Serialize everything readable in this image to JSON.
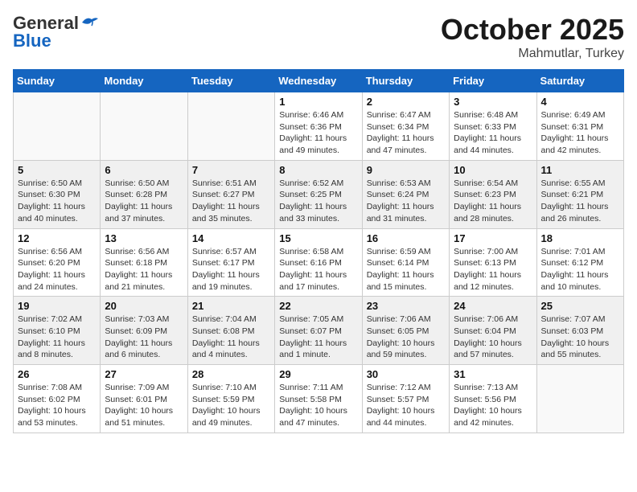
{
  "header": {
    "logo_general": "General",
    "logo_blue": "Blue",
    "month": "October 2025",
    "location": "Mahmutlar, Turkey"
  },
  "days_of_week": [
    "Sunday",
    "Monday",
    "Tuesday",
    "Wednesday",
    "Thursday",
    "Friday",
    "Saturday"
  ],
  "weeks": [
    [
      {
        "day": "",
        "info": ""
      },
      {
        "day": "",
        "info": ""
      },
      {
        "day": "",
        "info": ""
      },
      {
        "day": "1",
        "info": "Sunrise: 6:46 AM\nSunset: 6:36 PM\nDaylight: 11 hours\nand 49 minutes."
      },
      {
        "day": "2",
        "info": "Sunrise: 6:47 AM\nSunset: 6:34 PM\nDaylight: 11 hours\nand 47 minutes."
      },
      {
        "day": "3",
        "info": "Sunrise: 6:48 AM\nSunset: 6:33 PM\nDaylight: 11 hours\nand 44 minutes."
      },
      {
        "day": "4",
        "info": "Sunrise: 6:49 AM\nSunset: 6:31 PM\nDaylight: 11 hours\nand 42 minutes."
      }
    ],
    [
      {
        "day": "5",
        "info": "Sunrise: 6:50 AM\nSunset: 6:30 PM\nDaylight: 11 hours\nand 40 minutes."
      },
      {
        "day": "6",
        "info": "Sunrise: 6:50 AM\nSunset: 6:28 PM\nDaylight: 11 hours\nand 37 minutes."
      },
      {
        "day": "7",
        "info": "Sunrise: 6:51 AM\nSunset: 6:27 PM\nDaylight: 11 hours\nand 35 minutes."
      },
      {
        "day": "8",
        "info": "Sunrise: 6:52 AM\nSunset: 6:25 PM\nDaylight: 11 hours\nand 33 minutes."
      },
      {
        "day": "9",
        "info": "Sunrise: 6:53 AM\nSunset: 6:24 PM\nDaylight: 11 hours\nand 31 minutes."
      },
      {
        "day": "10",
        "info": "Sunrise: 6:54 AM\nSunset: 6:23 PM\nDaylight: 11 hours\nand 28 minutes."
      },
      {
        "day": "11",
        "info": "Sunrise: 6:55 AM\nSunset: 6:21 PM\nDaylight: 11 hours\nand 26 minutes."
      }
    ],
    [
      {
        "day": "12",
        "info": "Sunrise: 6:56 AM\nSunset: 6:20 PM\nDaylight: 11 hours\nand 24 minutes."
      },
      {
        "day": "13",
        "info": "Sunrise: 6:56 AM\nSunset: 6:18 PM\nDaylight: 11 hours\nand 21 minutes."
      },
      {
        "day": "14",
        "info": "Sunrise: 6:57 AM\nSunset: 6:17 PM\nDaylight: 11 hours\nand 19 minutes."
      },
      {
        "day": "15",
        "info": "Sunrise: 6:58 AM\nSunset: 6:16 PM\nDaylight: 11 hours\nand 17 minutes."
      },
      {
        "day": "16",
        "info": "Sunrise: 6:59 AM\nSunset: 6:14 PM\nDaylight: 11 hours\nand 15 minutes."
      },
      {
        "day": "17",
        "info": "Sunrise: 7:00 AM\nSunset: 6:13 PM\nDaylight: 11 hours\nand 12 minutes."
      },
      {
        "day": "18",
        "info": "Sunrise: 7:01 AM\nSunset: 6:12 PM\nDaylight: 11 hours\nand 10 minutes."
      }
    ],
    [
      {
        "day": "19",
        "info": "Sunrise: 7:02 AM\nSunset: 6:10 PM\nDaylight: 11 hours\nand 8 minutes."
      },
      {
        "day": "20",
        "info": "Sunrise: 7:03 AM\nSunset: 6:09 PM\nDaylight: 11 hours\nand 6 minutes."
      },
      {
        "day": "21",
        "info": "Sunrise: 7:04 AM\nSunset: 6:08 PM\nDaylight: 11 hours\nand 4 minutes."
      },
      {
        "day": "22",
        "info": "Sunrise: 7:05 AM\nSunset: 6:07 PM\nDaylight: 11 hours\nand 1 minute."
      },
      {
        "day": "23",
        "info": "Sunrise: 7:06 AM\nSunset: 6:05 PM\nDaylight: 10 hours\nand 59 minutes."
      },
      {
        "day": "24",
        "info": "Sunrise: 7:06 AM\nSunset: 6:04 PM\nDaylight: 10 hours\nand 57 minutes."
      },
      {
        "day": "25",
        "info": "Sunrise: 7:07 AM\nSunset: 6:03 PM\nDaylight: 10 hours\nand 55 minutes."
      }
    ],
    [
      {
        "day": "26",
        "info": "Sunrise: 7:08 AM\nSunset: 6:02 PM\nDaylight: 10 hours\nand 53 minutes."
      },
      {
        "day": "27",
        "info": "Sunrise: 7:09 AM\nSunset: 6:01 PM\nDaylight: 10 hours\nand 51 minutes."
      },
      {
        "day": "28",
        "info": "Sunrise: 7:10 AM\nSunset: 5:59 PM\nDaylight: 10 hours\nand 49 minutes."
      },
      {
        "day": "29",
        "info": "Sunrise: 7:11 AM\nSunset: 5:58 PM\nDaylight: 10 hours\nand 47 minutes."
      },
      {
        "day": "30",
        "info": "Sunrise: 7:12 AM\nSunset: 5:57 PM\nDaylight: 10 hours\nand 44 minutes."
      },
      {
        "day": "31",
        "info": "Sunrise: 7:13 AM\nSunset: 5:56 PM\nDaylight: 10 hours\nand 42 minutes."
      },
      {
        "day": "",
        "info": ""
      }
    ]
  ]
}
